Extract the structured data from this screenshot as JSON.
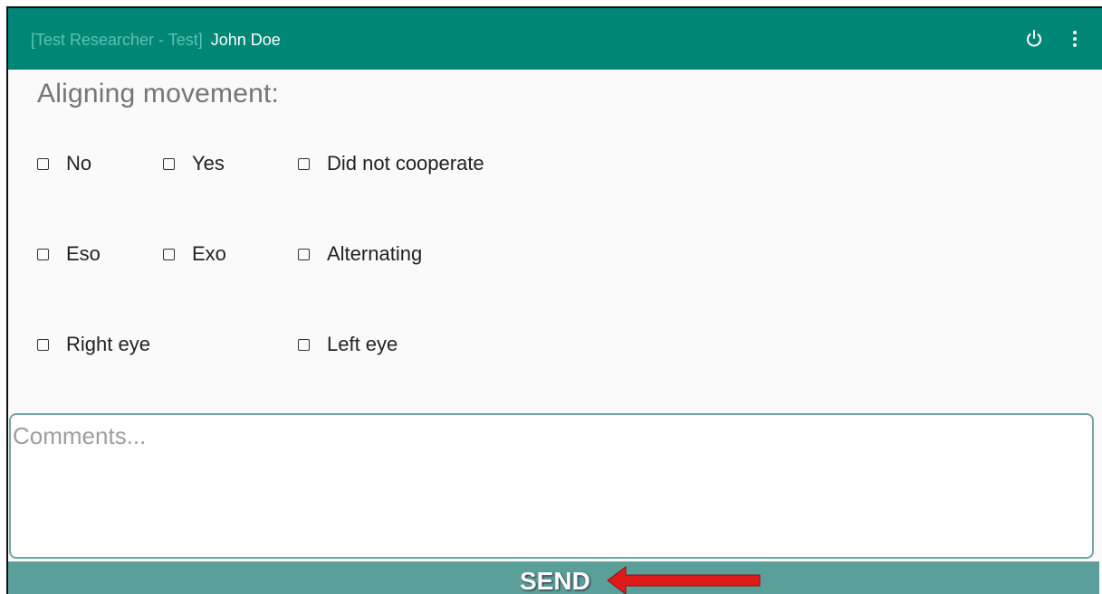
{
  "appbar": {
    "researcher_label": "[Test Researcher  - Test]",
    "user_name": "John Doe",
    "power_icon": "power-icon",
    "menu_icon": "more-vert-icon",
    "bg_color": "#008675"
  },
  "form": {
    "heading": "Aligning movement:",
    "rows": [
      [
        {
          "label": "No"
        },
        {
          "label": "Yes"
        },
        {
          "label": "Did not cooperate"
        }
      ],
      [
        {
          "label": "Eso"
        },
        {
          "label": "Exo"
        },
        {
          "label": "Alternating"
        }
      ],
      [
        {
          "label": "Right eye"
        },
        {
          "label": "Left eye"
        }
      ]
    ],
    "comments_placeholder": "Comments...",
    "send_label": "SEND"
  },
  "annotation": {
    "arrow_color": "#e01b1b"
  }
}
